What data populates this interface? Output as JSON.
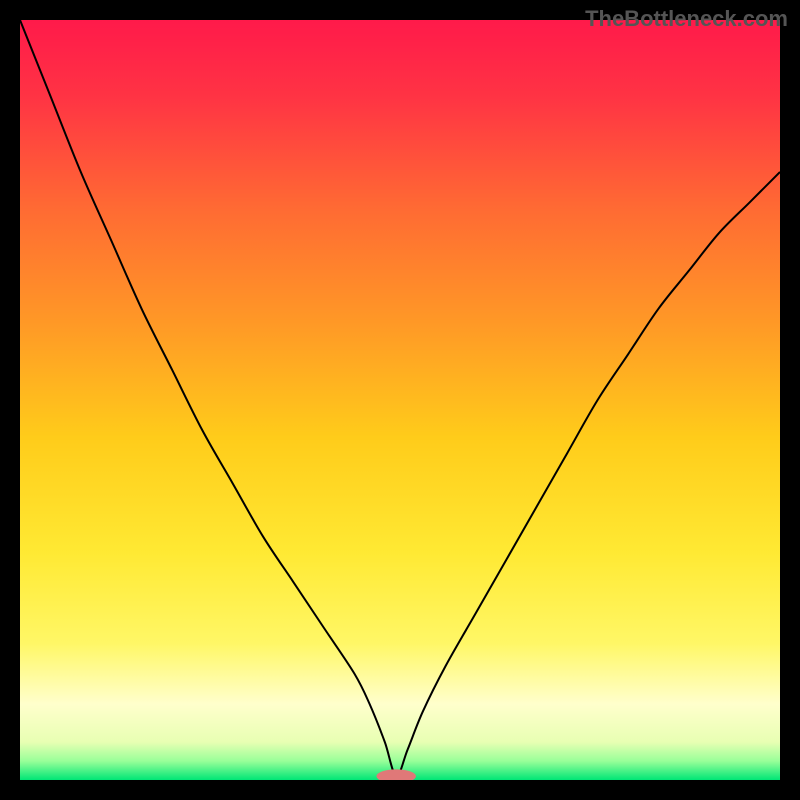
{
  "watermark": "TheBottleneck.com",
  "chart_data": {
    "type": "line",
    "title": "",
    "xlabel": "",
    "ylabel": "",
    "xlim": [
      0,
      100
    ],
    "ylim": [
      0,
      100
    ],
    "background_gradient": {
      "stops": [
        {
          "offset": 0.0,
          "color": "#ff1a4a"
        },
        {
          "offset": 0.1,
          "color": "#ff3344"
        },
        {
          "offset": 0.25,
          "color": "#ff6b33"
        },
        {
          "offset": 0.4,
          "color": "#ff9926"
        },
        {
          "offset": 0.55,
          "color": "#ffcc1a"
        },
        {
          "offset": 0.7,
          "color": "#ffe933"
        },
        {
          "offset": 0.82,
          "color": "#fff766"
        },
        {
          "offset": 0.9,
          "color": "#ffffcc"
        },
        {
          "offset": 0.95,
          "color": "#e8ffb3"
        },
        {
          "offset": 0.975,
          "color": "#99ff99"
        },
        {
          "offset": 1.0,
          "color": "#00e676"
        }
      ]
    },
    "series": [
      {
        "name": "curve",
        "color": "#000000",
        "stroke_width": 2,
        "x": [
          0,
          4,
          8,
          12,
          16,
          20,
          24,
          28,
          32,
          36,
          40,
          44,
          46,
          48,
          49.5,
          51,
          53,
          56,
          60,
          64,
          68,
          72,
          76,
          80,
          84,
          88,
          92,
          96,
          100
        ],
        "y": [
          100,
          90,
          80,
          71,
          62,
          54,
          46,
          39,
          32,
          26,
          20,
          14,
          10,
          5,
          0.5,
          4,
          9,
          15,
          22,
          29,
          36,
          43,
          50,
          56,
          62,
          67,
          72,
          76,
          80
        ]
      }
    ],
    "marker": {
      "cx": 49.5,
      "cy": 0.5,
      "rx": 2.6,
      "ry": 0.9,
      "color": "#e07878"
    }
  }
}
